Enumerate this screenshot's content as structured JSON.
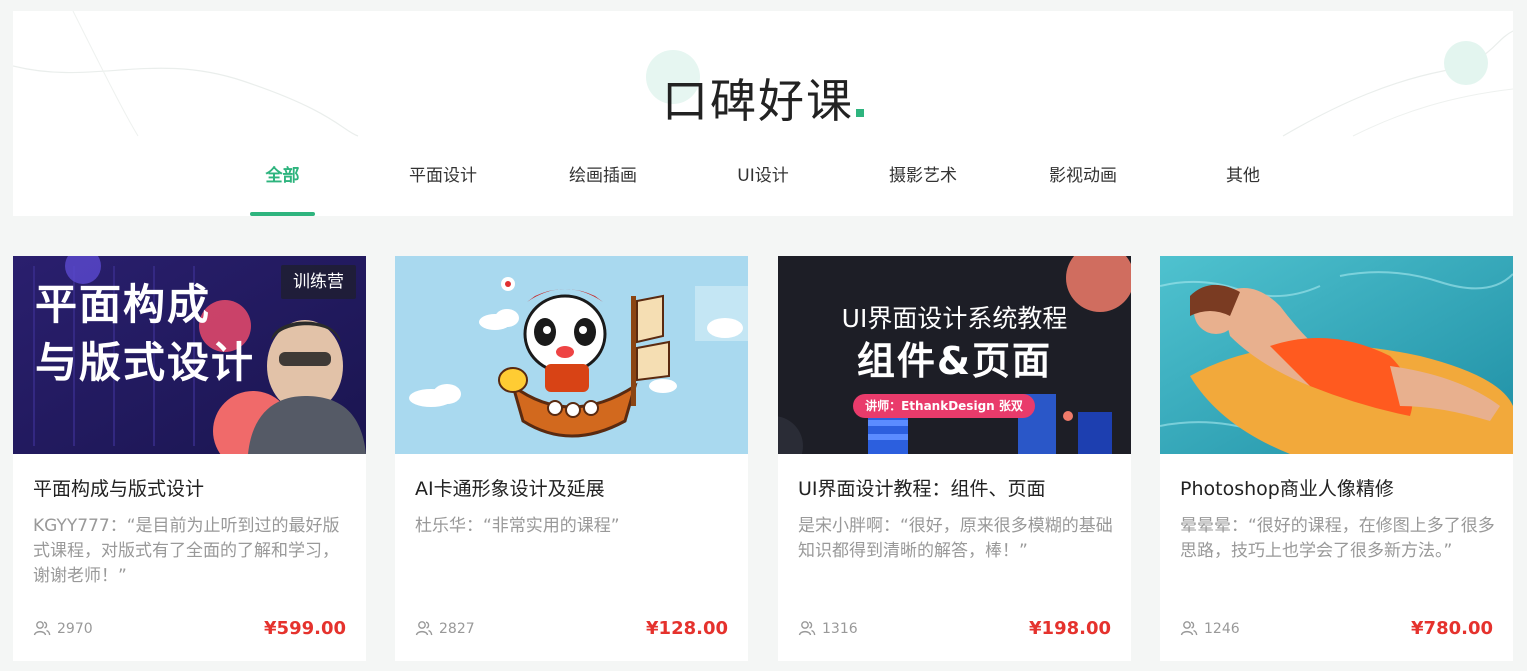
{
  "section": {
    "title": "口碑好课",
    "accent_color": "#2eb47e"
  },
  "tabs": [
    {
      "label": "全部",
      "active": true
    },
    {
      "label": "平面设计",
      "active": false
    },
    {
      "label": "绘画插画",
      "active": false
    },
    {
      "label": "UI设计",
      "active": false
    },
    {
      "label": "摄影艺术",
      "active": false
    },
    {
      "label": "影视动画",
      "active": false
    },
    {
      "label": "其他",
      "active": false
    }
  ],
  "courses": [
    {
      "title": "平面构成与版式设计",
      "review": "KGYY777：“是目前为止听到过的最好版式课程，对版式有了全面的了解和学习，谢谢老师！”",
      "students": "2970",
      "price": "¥599.00",
      "badge": "训练营",
      "cover_text": [
        "平面构成",
        "与版式设计"
      ]
    },
    {
      "title": "AI卡通形象设计及延展",
      "review": "杜乐华：“非常实用的课程”",
      "students": "2827",
      "price": "¥128.00"
    },
    {
      "title": "UI界面设计教程：组件、页面",
      "review": "是宋小胖啊：“很好，原来很多模糊的基础知识都得到清晰的解答，棒！”",
      "students": "1316",
      "price": "¥198.00",
      "cover_text": [
        "UI界面设计系统教程",
        "组件&页面",
        "讲师：EthankDesign 张双"
      ]
    },
    {
      "title": "Photoshop商业人像精修",
      "review": "晕晕晕：“很好的课程，在修图上多了很多思路，技巧上也学会了很多新方法。”",
      "students": "1246",
      "price": "¥780.00"
    }
  ],
  "icons": {
    "students": "users-icon"
  },
  "colors": {
    "price": "#e5322d",
    "active_tab": "#2eb47e"
  }
}
